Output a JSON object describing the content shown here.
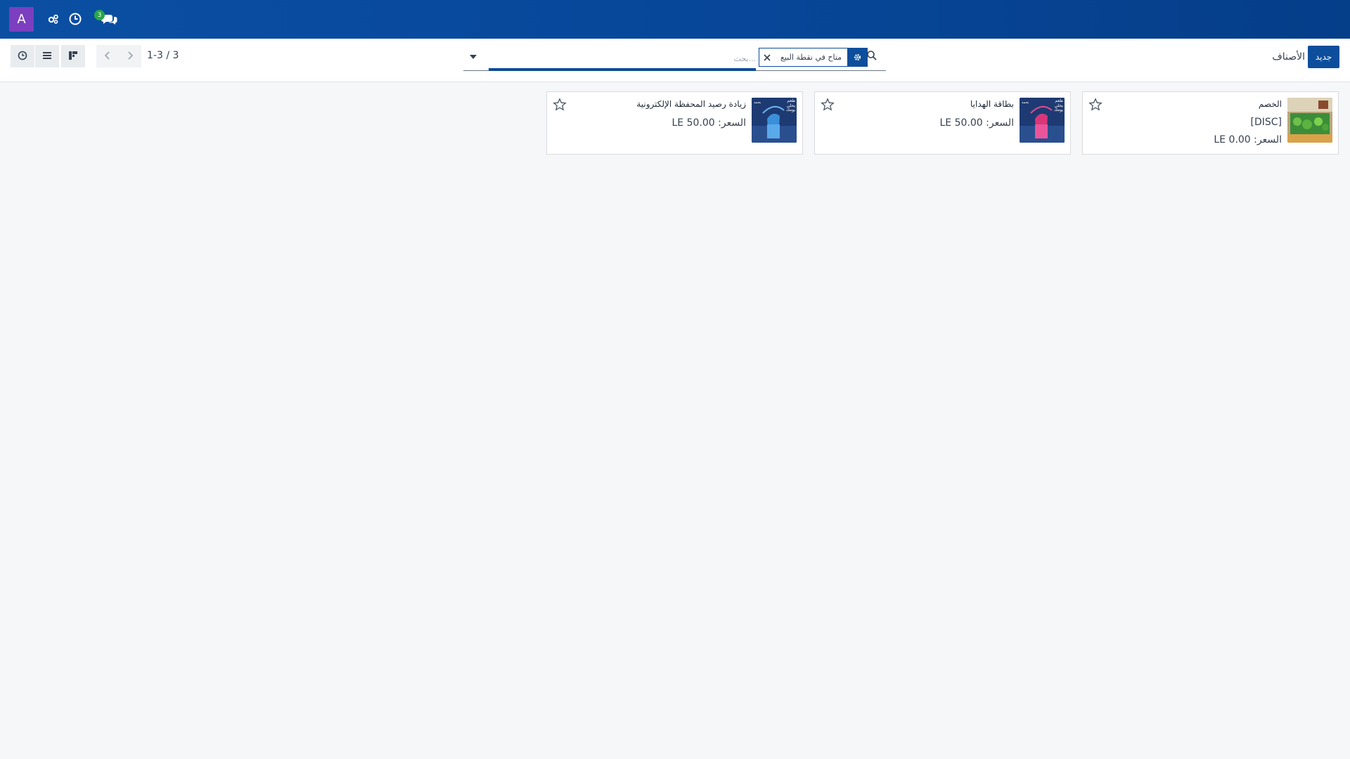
{
  "navbar": {
    "avatar_letter": "A",
    "messages_badge": "3",
    "colors": {
      "background": "#0b4fa3",
      "avatar": "#7b3fbf",
      "badge": "#28a745"
    }
  },
  "control_panel": {
    "new_button": "جديد",
    "breadcrumb": "الأصناف",
    "search": {
      "facet_label": "متاح في نقطة البيع",
      "placeholder": "بحث..."
    },
    "pager": "1-3 / 3"
  },
  "products": [
    {
      "name": "الخصم",
      "ref": "[DISC]",
      "price": "السعر: 0.00 LE",
      "thumb": "discount-photo"
    },
    {
      "name": "بطاقة الهدايا",
      "ref": "",
      "price": "السعر: 50.00 LE",
      "thumb": "pink-drink-can"
    },
    {
      "name": "زيادة رصيد المحفظة الإلكترونية",
      "ref": "",
      "price": "السعر: 50.00 LE",
      "thumb": "blue-drink-can"
    }
  ],
  "thumbnail_caption": "طعم يحلي يومك",
  "thumbnail_brand": "يحمه"
}
